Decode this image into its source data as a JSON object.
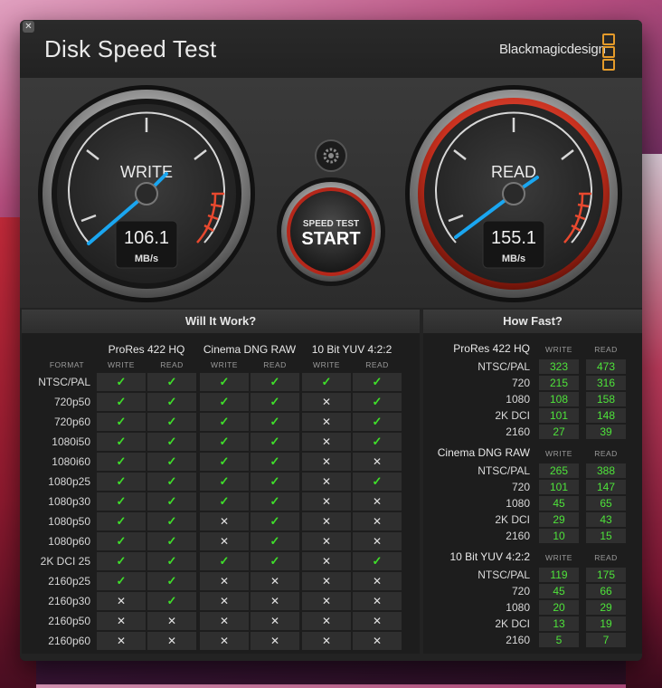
{
  "window": {
    "title": "Disk Speed Test",
    "brand": "Blackmagicdesign"
  },
  "write_gauge": {
    "label": "WRITE",
    "value": "106.1",
    "unit": "MB/s"
  },
  "read_gauge": {
    "label": "READ",
    "value": "155.1",
    "unit": "MB/s"
  },
  "start_button": {
    "line1": "SPEED TEST",
    "line2": "START"
  },
  "will_it_work": {
    "title": "Will It Work?",
    "format_label": "FORMAT",
    "write_label": "WRITE",
    "read_label": "READ",
    "groups": [
      "ProRes 422 HQ",
      "Cinema DNG RAW",
      "10 Bit YUV 4:2:2"
    ],
    "rows": [
      {
        "format": "NTSC/PAL",
        "vals": [
          1,
          1,
          1,
          1,
          1,
          1
        ]
      },
      {
        "format": "720p50",
        "vals": [
          1,
          1,
          1,
          1,
          0,
          1
        ]
      },
      {
        "format": "720p60",
        "vals": [
          1,
          1,
          1,
          1,
          0,
          1
        ]
      },
      {
        "format": "1080i50",
        "vals": [
          1,
          1,
          1,
          1,
          0,
          1
        ]
      },
      {
        "format": "1080i60",
        "vals": [
          1,
          1,
          1,
          1,
          0,
          0
        ]
      },
      {
        "format": "1080p25",
        "vals": [
          1,
          1,
          1,
          1,
          0,
          1
        ]
      },
      {
        "format": "1080p30",
        "vals": [
          1,
          1,
          1,
          1,
          0,
          0
        ]
      },
      {
        "format": "1080p50",
        "vals": [
          1,
          1,
          0,
          1,
          0,
          0
        ]
      },
      {
        "format": "1080p60",
        "vals": [
          1,
          1,
          0,
          1,
          0,
          0
        ]
      },
      {
        "format": "2K DCI 25",
        "vals": [
          1,
          1,
          1,
          1,
          0,
          1
        ]
      },
      {
        "format": "2160p25",
        "vals": [
          1,
          1,
          0,
          0,
          0,
          0
        ]
      },
      {
        "format": "2160p30",
        "vals": [
          0,
          1,
          0,
          0,
          0,
          0
        ]
      },
      {
        "format": "2160p50",
        "vals": [
          0,
          0,
          0,
          0,
          0,
          0
        ]
      },
      {
        "format": "2160p60",
        "vals": [
          0,
          0,
          0,
          0,
          0,
          0
        ]
      }
    ]
  },
  "how_fast": {
    "title": "How Fast?",
    "write_label": "WRITE",
    "read_label": "READ",
    "groups": [
      {
        "name": "ProRes 422 HQ",
        "rows": [
          {
            "label": "NTSC/PAL",
            "write": "323",
            "read": "473"
          },
          {
            "label": "720",
            "write": "215",
            "read": "316"
          },
          {
            "label": "1080",
            "write": "108",
            "read": "158"
          },
          {
            "label": "2K DCI",
            "write": "101",
            "read": "148"
          },
          {
            "label": "2160",
            "write": "27",
            "read": "39"
          }
        ]
      },
      {
        "name": "Cinema DNG RAW",
        "rows": [
          {
            "label": "NTSC/PAL",
            "write": "265",
            "read": "388"
          },
          {
            "label": "720",
            "write": "101",
            "read": "147"
          },
          {
            "label": "1080",
            "write": "45",
            "read": "65"
          },
          {
            "label": "2K DCI",
            "write": "29",
            "read": "43"
          },
          {
            "label": "2160",
            "write": "10",
            "read": "15"
          }
        ]
      },
      {
        "name": "10 Bit YUV 4:2:2",
        "rows": [
          {
            "label": "NTSC/PAL",
            "write": "119",
            "read": "175"
          },
          {
            "label": "720",
            "write": "45",
            "read": "66"
          },
          {
            "label": "1080",
            "write": "20",
            "read": "29"
          },
          {
            "label": "2K DCI",
            "write": "13",
            "read": "19"
          },
          {
            "label": "2160",
            "write": "5",
            "read": "7"
          }
        ]
      }
    ]
  },
  "icons": {
    "close": "close-icon",
    "settings": "gear-icon",
    "check": "✓",
    "cross": "✕"
  },
  "colors": {
    "needle": "#1aa6f0",
    "read_ring": "#d8402c",
    "ok": "#3fe02a",
    "logo": "#e59b2a"
  }
}
